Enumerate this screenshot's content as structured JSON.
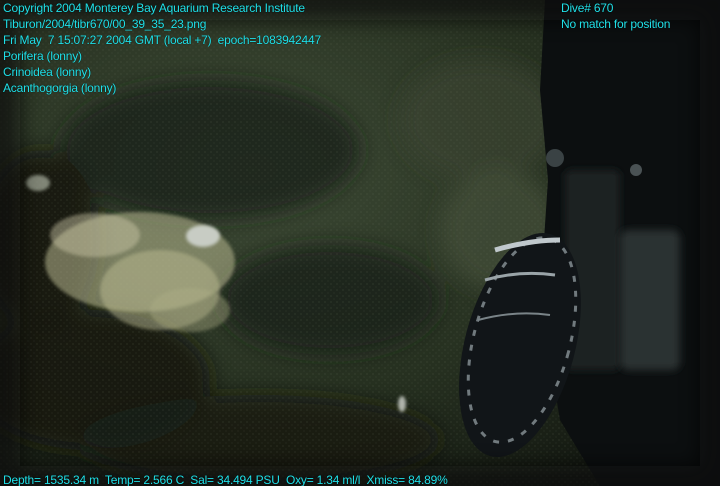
{
  "overlay": {
    "text_color": "#20e0e8",
    "top_left": {
      "copyright": "Copyright 2004 Monterey Bay Aquarium Research Institute",
      "file": "Tiburon/2004/tibr670/00_39_35_23.png",
      "datetime": "Fri May  7 15:07:27 2004 GMT (local +7)  epoch=1083942447",
      "labels": [
        "Porifera (lonny)",
        "Crinoidea (lonny)",
        "Acanthogorgia (lonny)"
      ]
    },
    "top_right": {
      "dive": "Dive# 670",
      "position": "No match for position"
    },
    "bottom": {
      "telemetry": "Depth= 1535.34 m  Temp= 2.566 C  Sal= 34.494 PSU  Oxy= 1.34 ml/l  Xmiss= 84.89%"
    }
  },
  "scene": {
    "seafloor_color": "#2c3526",
    "rock_color": "#1a2016",
    "sediment_color": "#4a5540",
    "coral_color": "#b8b890",
    "rov_arm_color": "#0c0f10"
  }
}
